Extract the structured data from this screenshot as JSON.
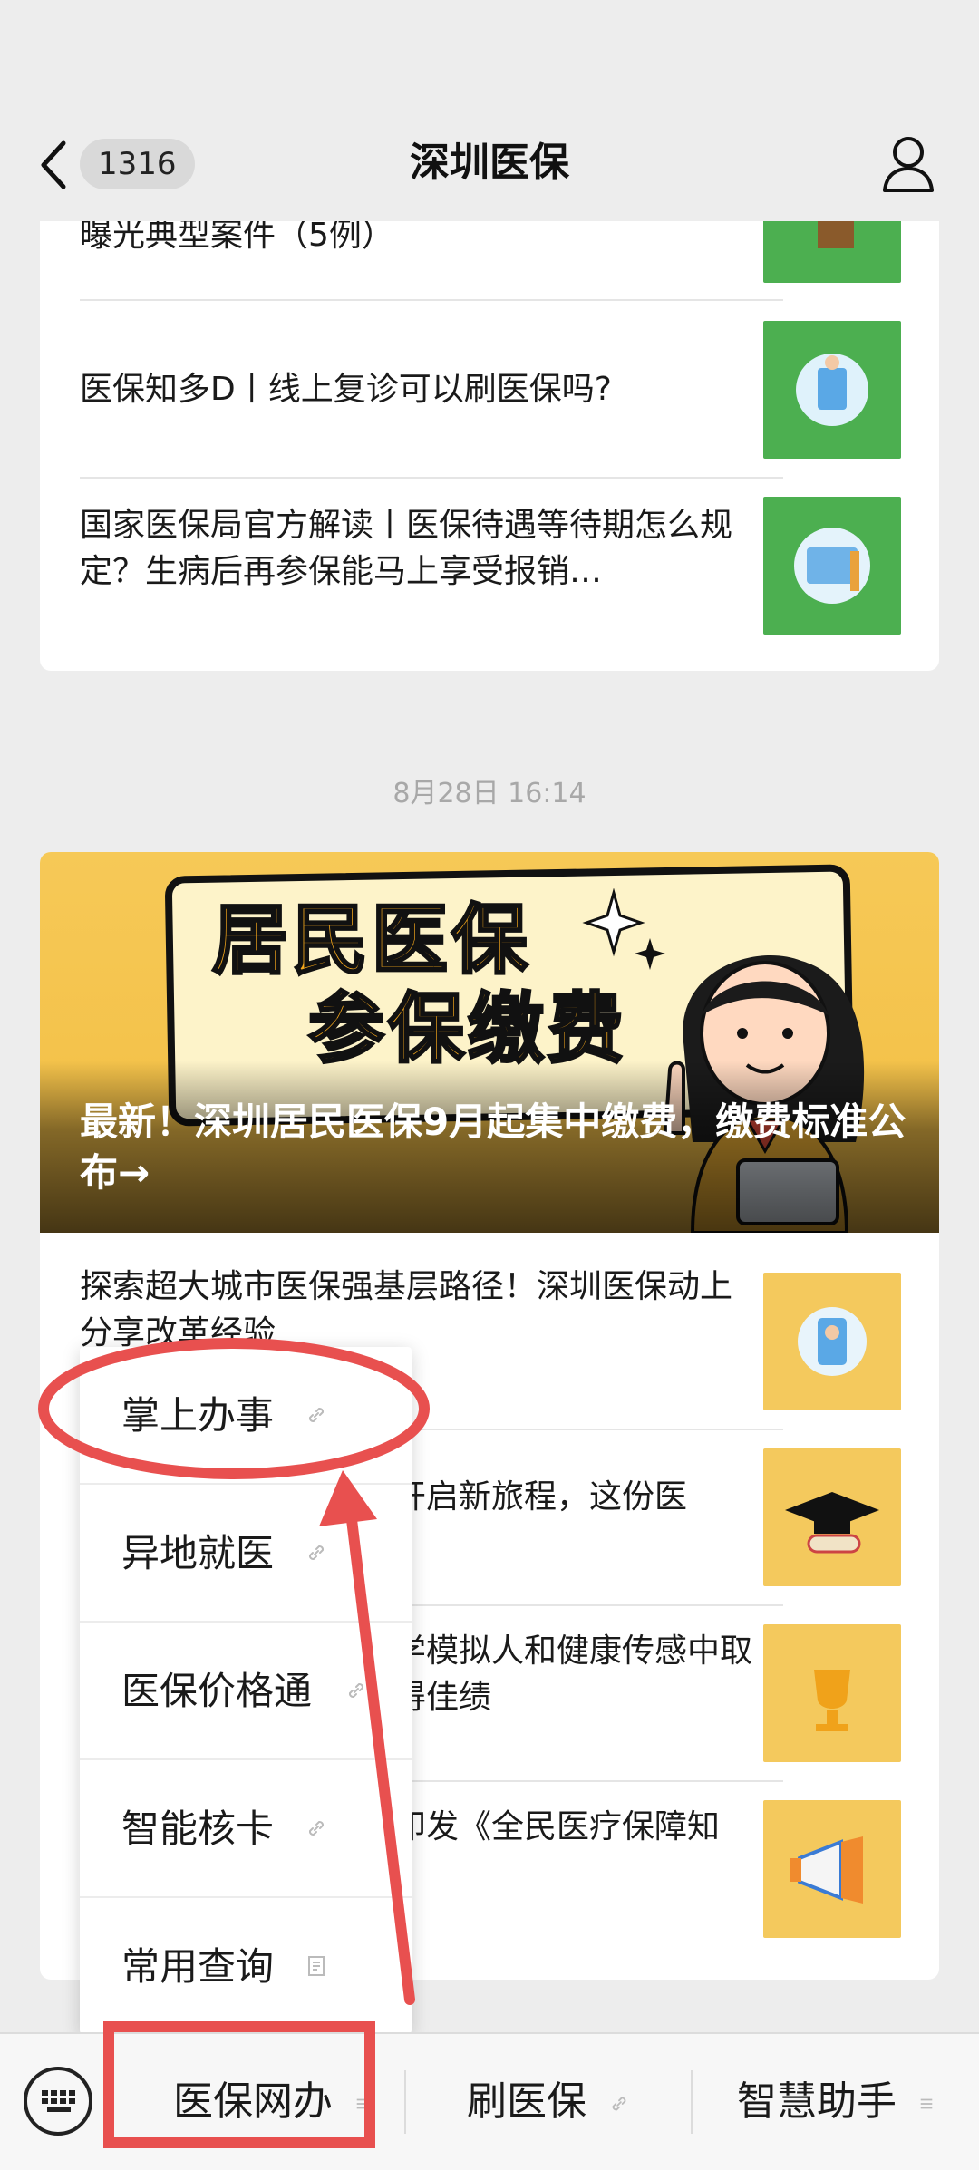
{
  "header": {
    "back_count": "1316",
    "title": "深圳医保"
  },
  "articles_top": [
    {
      "title": "曝光典型案件（5例）",
      "thumb_color": "#4caf50"
    },
    {
      "title": "医保知多D丨线上复诊可以刷医保吗?",
      "thumb_color": "#4caf50"
    },
    {
      "title": "国家医保局官方解读丨医保待遇等待期怎么规定？生病后再参保能马上享受报销…",
      "thumb_color": "#4caf50"
    }
  ],
  "timestamp": "8月28日 16:14",
  "hero": {
    "big_line1": "居民医保",
    "big_line2": "参保缴费",
    "caption": "最新！深圳居民医保9月起集中缴费，缴费标准公布→"
  },
  "articles_bottom": [
    {
      "title": "探索超大城市医保强基层路径！深圳医保动上分享改革经验",
      "thumb_color": "#f4c95d"
    },
    {
      "title": "开启新旅程，这份医",
      "thumb_color": "#f4c95d"
    },
    {
      "title": "学模拟人和健康传感中取得佳绩",
      "thumb_color": "#f4c95d"
    },
    {
      "title": "印发《全民医疗保障知",
      "thumb_color": "#f4c95d"
    }
  ],
  "menu": {
    "items": [
      {
        "label": "掌上办事",
        "icon": "link-icon"
      },
      {
        "label": "异地就医",
        "icon": "link-icon"
      },
      {
        "label": "医保价格通",
        "icon": "link-icon"
      },
      {
        "label": "智能核卡",
        "icon": "link-icon"
      },
      {
        "label": "常用查询",
        "icon": "document-icon"
      }
    ]
  },
  "bottom_bar": {
    "items": [
      {
        "label": "医保网办",
        "icon": "menu-lines-icon"
      },
      {
        "label": "刷医保",
        "icon": "link-icon"
      },
      {
        "label": "智慧助手",
        "icon": "menu-lines-icon"
      }
    ]
  },
  "colors": {
    "annotation": "#e8504f",
    "green_thumb": "#4caf50",
    "yellow_thumb": "#f4c95d"
  }
}
